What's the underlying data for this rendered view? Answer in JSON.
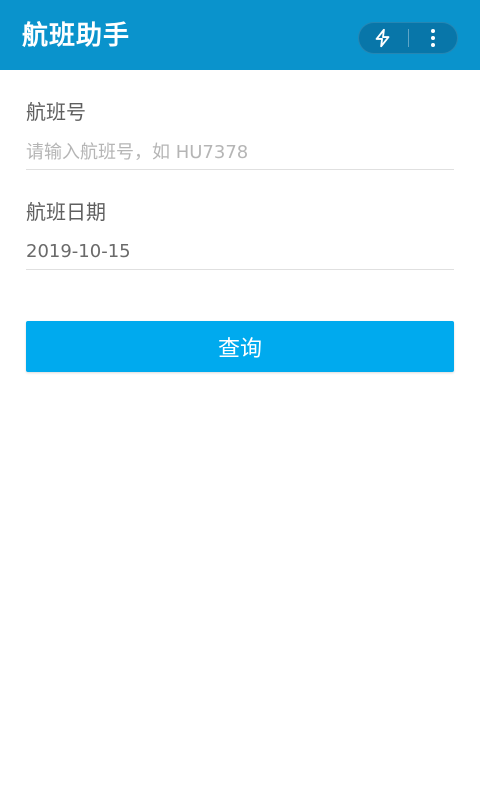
{
  "app": {
    "title": "航班助手"
  },
  "capsule": {
    "left_icon": "flash-icon",
    "right_icon": "more-vertical-icon"
  },
  "form": {
    "flight_no_label": "航班号",
    "flight_no_placeholder": "请输入航班号，如 HU7378",
    "flight_no_value": "",
    "date_label": "航班日期",
    "date_value": "2019-10-15"
  },
  "actions": {
    "query_label": "查询"
  },
  "colors": {
    "appbar": "#0a93cc",
    "button": "#00aaee",
    "text_muted": "#5f5f5f",
    "divider": "#e0e0e0"
  }
}
